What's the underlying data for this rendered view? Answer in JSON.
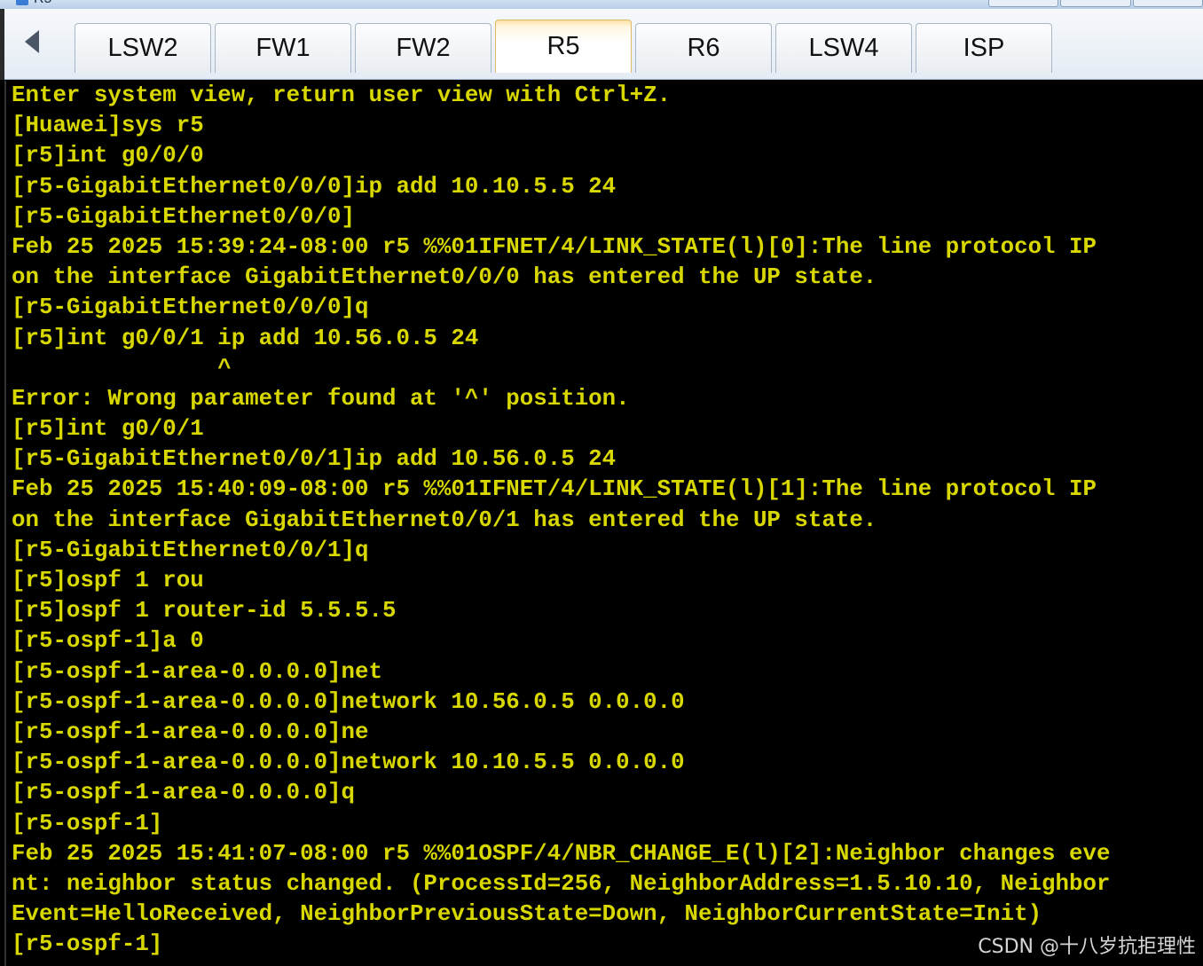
{
  "window": {
    "title": "R5"
  },
  "tabs": [
    {
      "label": "LSW2",
      "active": false
    },
    {
      "label": "FW1",
      "active": false
    },
    {
      "label": "FW2",
      "active": false
    },
    {
      "label": "R5",
      "active": true
    },
    {
      "label": "R6",
      "active": false
    },
    {
      "label": "LSW4",
      "active": false
    },
    {
      "label": "ISP",
      "active": false
    }
  ],
  "colors": {
    "console_bg": "#000000",
    "console_text": "#d8d800",
    "active_tab_accent": "#ffe2a6"
  },
  "console": {
    "lines": [
      "Enter system view, return user view with Ctrl+Z.",
      "[Huawei]sys r5",
      "[r5]int g0/0/0",
      "[r5-GigabitEthernet0/0/0]ip add 10.10.5.5 24",
      "[r5-GigabitEthernet0/0/0]",
      "Feb 25 2025 15:39:24-08:00 r5 %%01IFNET/4/LINK_STATE(l)[0]:The line protocol IP",
      "on the interface GigabitEthernet0/0/0 has entered the UP state.",
      "[r5-GigabitEthernet0/0/0]q",
      "[r5]int g0/0/1 ip add 10.56.0.5 24",
      "               ^",
      "Error: Wrong parameter found at '^' position.",
      "[r5]int g0/0/1",
      "[r5-GigabitEthernet0/0/1]ip add 10.56.0.5 24",
      "Feb 25 2025 15:40:09-08:00 r5 %%01IFNET/4/LINK_STATE(l)[1]:The line protocol IP",
      "on the interface GigabitEthernet0/0/1 has entered the UP state.",
      "[r5-GigabitEthernet0/0/1]q",
      "[r5]ospf 1 rou",
      "[r5]ospf 1 router-id 5.5.5.5",
      "[r5-ospf-1]a 0",
      "[r5-ospf-1-area-0.0.0.0]net",
      "[r5-ospf-1-area-0.0.0.0]network 10.56.0.5 0.0.0.0",
      "[r5-ospf-1-area-0.0.0.0]ne",
      "[r5-ospf-1-area-0.0.0.0]network 10.10.5.5 0.0.0.0",
      "[r5-ospf-1-area-0.0.0.0]q",
      "[r5-ospf-1]",
      "Feb 25 2025 15:41:07-08:00 r5 %%01OSPF/4/NBR_CHANGE_E(l)[2]:Neighbor changes eve",
      "nt: neighbor status changed. (ProcessId=256, NeighborAddress=1.5.10.10, Neighbor",
      "Event=HelloReceived, NeighborPreviousState=Down, NeighborCurrentState=Init)",
      "[r5-ospf-1]"
    ]
  },
  "watermark": "CSDN @十八岁抗拒理性"
}
